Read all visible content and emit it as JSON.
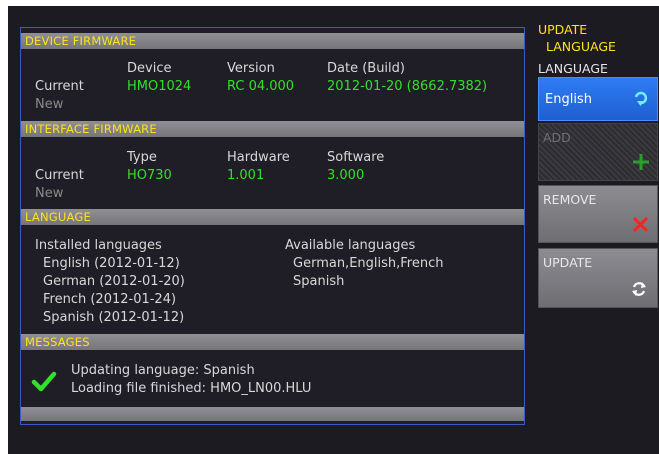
{
  "sections": {
    "device_firmware": {
      "title": "DEVICE FIRMWARE",
      "col_device": "Device",
      "col_version": "Version",
      "col_date": "Date (Build)",
      "row_current": "Current",
      "row_new": "New",
      "device": "HMO1024",
      "version": "RC 04.000",
      "date": "2012-01-20 (8662.7382)"
    },
    "interface_firmware": {
      "title": "INTERFACE FIRMWARE",
      "col_type": "Type",
      "col_hardware": "Hardware",
      "col_software": "Software",
      "row_current": "Current",
      "row_new": "New",
      "type": "HO730",
      "hardware": "1.001",
      "software": "3.000"
    },
    "language": {
      "title": "LANGUAGE",
      "installed_heading": "Installed languages",
      "installed": [
        "English (2012-01-12)",
        "German (2012-01-20)",
        "French (2012-01-24)",
        "Spanish (2012-01-12)"
      ],
      "available_heading": "Available languages",
      "available": [
        "German,English,French",
        "Spanish"
      ]
    },
    "messages": {
      "title": "MESSAGES",
      "lines": [
        "Updating language: Spanish",
        "Loading file finished: HMO_LN00.HLU"
      ]
    }
  },
  "sidebar": {
    "title_line1": "UPDATE",
    "title_line2": "LANGUAGE",
    "language_label": "LANGUAGE",
    "language_value": "English",
    "add_label": "ADD",
    "remove_label": "REMOVE",
    "update_label": "UPDATE"
  },
  "colors": {
    "header_text": "#ffe21a",
    "value_green": "#31e02a",
    "selected_blue": "#2f7cf2",
    "remove_red": "#ff2020"
  }
}
